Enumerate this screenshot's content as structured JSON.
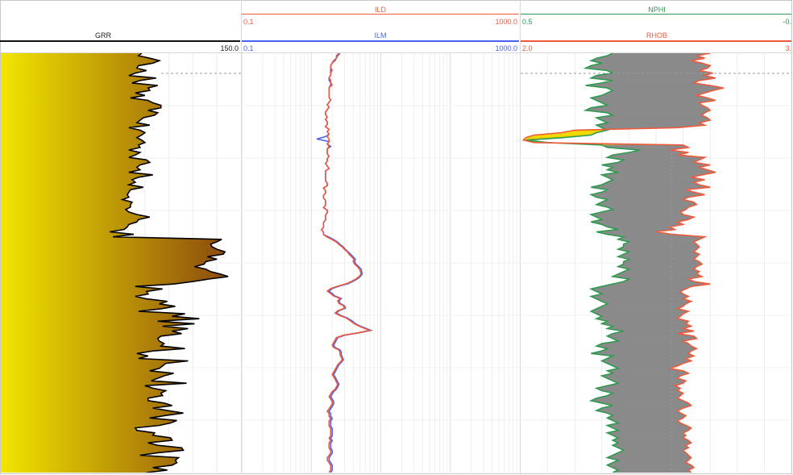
{
  "chart_data": {
    "type": "line",
    "depth_axis": "vertical (top to bottom)",
    "tracks": [
      {
        "name": "gamma-ray-track",
        "curves": [
          {
            "mnemonic": "GRR",
            "color": "#000000",
            "scale_min": null,
            "scale_max": "150.0",
            "fill": "yellow-to-brown gradient (left of curve)"
          }
        ]
      },
      {
        "name": "resistivity-track",
        "scale": "log",
        "curves": [
          {
            "mnemonic": "ILD",
            "color": "#ef5a3c",
            "scale_min": "0.1",
            "scale_max": "1000.0"
          },
          {
            "mnemonic": "ILM",
            "color": "#4a63f0",
            "scale_min": "0.1",
            "scale_max": "1000.0"
          }
        ]
      },
      {
        "name": "porosity-density-track",
        "curves": [
          {
            "mnemonic": "NPHI",
            "color": "#2e9a4f",
            "scale_min": "0.5",
            "scale_max": "-0."
          },
          {
            "mnemonic": "RHOB",
            "color": "#ef5a3c",
            "scale_min": "2.0",
            "scale_max": "3."
          }
        ],
        "fills": [
          "grey crossover",
          "yellow crossover"
        ]
      }
    ],
    "series": [
      {
        "track": 0,
        "name": "GRR",
        "color": "#000000",
        "values": [
          88,
          86,
          93,
          99,
          95,
          86,
          85,
          91,
          84,
          80,
          97,
          87,
          82,
          98,
          92,
          93,
          84,
          90,
          81,
          92,
          95,
          100,
          100,
          92,
          98,
          96,
          89,
          87,
          85,
          93,
          80,
          87,
          90,
          88,
          85,
          88,
          90,
          86,
          87,
          80,
          87,
          84,
          80,
          91,
          93,
          87,
          85,
          87,
          80,
          95,
          86,
          82,
          84,
          80,
          89,
          81,
          80,
          79,
          80,
          76,
          82,
          81,
          81,
          78,
          80,
          85,
          93,
          86,
          85,
          80,
          79,
          77,
          68,
          83,
          70,
          138,
          135,
          131,
          132,
          135,
          140,
          139,
          129,
          135,
          128,
          127,
          121,
          128,
          131,
          137,
          142,
          130,
          120,
          108,
          84,
          101,
          91,
          92,
          84,
          91,
          104,
          99,
          109,
          100,
          86,
          115,
          107,
          124,
          98,
          121,
          101,
          117,
          107,
          113,
          100,
          98,
          99,
          102,
          100,
          115,
          95,
          85,
          92,
          86,
          117,
          103,
          101,
          99,
          93,
          108,
          102,
          98,
          94,
          116,
          90,
          95,
          103,
          100,
          101,
          92,
          92,
          102,
          107,
          95,
          104,
          114,
          103,
          93,
          110,
          106,
          99,
          84,
          85,
          96,
          95,
          106,
          107,
          92,
          98,
          113,
          114,
          98,
          87,
          111,
          109,
          110,
          107,
          95,
          104,
          91
        ]
      },
      {
        "track": 1,
        "name": "ILD",
        "color": "#ef5a3c",
        "values": [
          2.5,
          2.3,
          2.3,
          2.1,
          2.0,
          1.9,
          1.9,
          2.0,
          1.9,
          1.9,
          1.8,
          1.9,
          1.9,
          2.0,
          1.8,
          1.8,
          1.8,
          1.8,
          1.8,
          1.9,
          1.8,
          1.7,
          1.8,
          1.7,
          1.6,
          1.6,
          1.7,
          1.6,
          1.7,
          1.7,
          1.6,
          1.8,
          1.7,
          1.8,
          1.7,
          1.8,
          1.8,
          1.7,
          1.8,
          1.7,
          1.7,
          1.7,
          1.8,
          1.7,
          1.7,
          1.6,
          1.7,
          1.8,
          1.6,
          1.6,
          1.6,
          1.6,
          1.6,
          1.7,
          1.7,
          1.5,
          1.6,
          1.6,
          1.5,
          1.5,
          1.6,
          1.6,
          1.6,
          1.5,
          1.7,
          1.7,
          1.6,
          1.6,
          1.6,
          1.5,
          1.5,
          1.5,
          1.4,
          1.5,
          1.5,
          1.7,
          2.0,
          2.3,
          2.5,
          2.8,
          3.0,
          3.3,
          3.5,
          3.8,
          4.1,
          4.0,
          4.2,
          4.6,
          4.9,
          5.1,
          5.2,
          4.9,
          4.4,
          3.8,
          3.2,
          2.4,
          1.9,
          1.7,
          1.9,
          2.1,
          2.6,
          2.4,
          2.5,
          2.9,
          3.0,
          2.4,
          2.2,
          2.6,
          3.2,
          3.6,
          4.0,
          4.6,
          5.6,
          6.9,
          4.7,
          2.9,
          2.3,
          2.2,
          2.1,
          2.0,
          2.1,
          2.5,
          2.6,
          2.6,
          2.7,
          2.8,
          2.6,
          2.4,
          2.3,
          2.2,
          2.1,
          2.0,
          2.1,
          2.2,
          2.3,
          2.4,
          2.3,
          2.2,
          2.0,
          1.9,
          1.8,
          1.9,
          2.0,
          2.0,
          1.9,
          1.8,
          1.7,
          1.8,
          1.8,
          1.9,
          1.8,
          1.8,
          1.8,
          1.9,
          1.9,
          1.9,
          1.9,
          1.8,
          1.9,
          1.8,
          1.8,
          1.8,
          1.9,
          1.9,
          1.8,
          1.7,
          1.7,
          1.8,
          1.9,
          1.9,
          1.9,
          1.8
        ]
      },
      {
        "track": 1,
        "name": "ILM",
        "color": "#4a63f0",
        "values": [
          2.6,
          2.4,
          2.3,
          2.2,
          2.0,
          1.9,
          1.9,
          1.9,
          1.9,
          1.9,
          1.8,
          1.8,
          1.9,
          1.9,
          1.8,
          1.8,
          1.8,
          1.8,
          1.8,
          1.9,
          1.8,
          1.7,
          1.8,
          1.7,
          1.6,
          1.6,
          1.7,
          1.6,
          1.7,
          1.7,
          1.6,
          1.8,
          1.7,
          1.8,
          1.6,
          1.2,
          1.8,
          1.7,
          1.9,
          1.7,
          1.7,
          1.7,
          1.8,
          1.7,
          1.7,
          1.6,
          1.7,
          1.8,
          1.6,
          1.6,
          1.6,
          1.6,
          1.6,
          1.7,
          1.7,
          1.5,
          1.6,
          1.6,
          1.5,
          1.5,
          1.6,
          1.6,
          1.6,
          1.5,
          1.7,
          1.7,
          1.6,
          1.6,
          1.6,
          1.5,
          1.5,
          1.5,
          1.4,
          1.5,
          1.5,
          1.8,
          2.1,
          2.4,
          2.6,
          2.9,
          3.1,
          3.4,
          3.7,
          4.0,
          4.3,
          4.2,
          4.4,
          4.8,
          5.2,
          5.3,
          5.4,
          5.1,
          4.6,
          4.0,
          3.4,
          2.5,
          2.0,
          1.8,
          2.0,
          2.2,
          2.7,
          2.5,
          2.6,
          3.0,
          3.1,
          2.5,
          2.3,
          2.7,
          3.3,
          3.8,
          4.2,
          4.8,
          5.9,
          7.2,
          4.9,
          3.0,
          2.4,
          2.3,
          2.2,
          2.1,
          2.2,
          2.6,
          2.7,
          2.7,
          2.8,
          2.9,
          2.7,
          2.5,
          2.4,
          2.3,
          2.2,
          2.1,
          2.2,
          2.3,
          2.4,
          2.5,
          2.4,
          2.3,
          2.1,
          2.0,
          1.9,
          2.0,
          2.1,
          2.1,
          2.0,
          1.9,
          1.8,
          1.9,
          1.9,
          2.0,
          1.9,
          1.9,
          1.9,
          2.0,
          2.0,
          2.0,
          2.0,
          1.9,
          2.0,
          1.9,
          1.9,
          1.9,
          2.0,
          2.0,
          1.9,
          1.8,
          1.8,
          1.9,
          2.0,
          2.0,
          2.0,
          1.9
        ]
      },
      {
        "track": 2,
        "name": "NPHI",
        "color": "#2e9a4f",
        "values": [
          0.33,
          0.34,
          0.36,
          0.37,
          0.35,
          0.37,
          0.38,
          0.34,
          0.33,
          0.36,
          0.37,
          0.33,
          0.35,
          0.38,
          0.34,
          0.33,
          0.34,
          0.35,
          0.37,
          0.36,
          0.35,
          0.34,
          0.37,
          0.38,
          0.34,
          0.33,
          0.36,
          0.35,
          0.34,
          0.36,
          0.35,
          0.34,
          0.36,
          0.37,
          0.42,
          0.49,
          0.45,
          0.35,
          0.34,
          0.28,
          0.3,
          0.33,
          0.34,
          0.31,
          0.32,
          0.35,
          0.33,
          0.34,
          0.32,
          0.35,
          0.34,
          0.33,
          0.34,
          0.35,
          0.37,
          0.34,
          0.35,
          0.37,
          0.36,
          0.34,
          0.35,
          0.36,
          0.34,
          0.33,
          0.35,
          0.37,
          0.36,
          0.35,
          0.37,
          0.35,
          0.34,
          0.32,
          0.36,
          0.34,
          0.31,
          0.32,
          0.3,
          0.31,
          0.31,
          0.32,
          0.3,
          0.31,
          0.32,
          0.3,
          0.31,
          0.31,
          0.32,
          0.3,
          0.31,
          0.32,
          0.33,
          0.3,
          0.31,
          0.33,
          0.35,
          0.37,
          0.36,
          0.35,
          0.37,
          0.36,
          0.35,
          0.34,
          0.35,
          0.36,
          0.37,
          0.36,
          0.35,
          0.36,
          0.34,
          0.35,
          0.33,
          0.34,
          0.31,
          0.33,
          0.34,
          0.33,
          0.32,
          0.35,
          0.36,
          0.34,
          0.35,
          0.37,
          0.33,
          0.34,
          0.35,
          0.34,
          0.33,
          0.32,
          0.34,
          0.33,
          0.35,
          0.34,
          0.33,
          0.32,
          0.34,
          0.36,
          0.35,
          0.33,
          0.34,
          0.36,
          0.37,
          0.35,
          0.33,
          0.35,
          0.36,
          0.34,
          0.33,
          0.34,
          0.33,
          0.32,
          0.34,
          0.33,
          0.32,
          0.34,
          0.33,
          0.32,
          0.33,
          0.32,
          0.33,
          0.32,
          0.31,
          0.32,
          0.33,
          0.34,
          0.32,
          0.33,
          0.34,
          0.33,
          0.32,
          0.33
        ]
      },
      {
        "track": 2,
        "name": "RHOB",
        "color": "#ef5a3c",
        "values": [
          2.7,
          2.65,
          2.68,
          2.63,
          2.67,
          2.7,
          2.69,
          2.66,
          2.71,
          2.68,
          2.72,
          2.66,
          2.64,
          2.7,
          2.75,
          2.71,
          2.68,
          2.65,
          2.69,
          2.72,
          2.66,
          2.67,
          2.69,
          2.7,
          2.68,
          2.67,
          2.69,
          2.7,
          2.66,
          2.68,
          2.58,
          2.2,
          2.15,
          2.05,
          2.02,
          2.01,
          2.05,
          2.6,
          2.62,
          2.55,
          2.62,
          2.58,
          2.68,
          2.66,
          2.64,
          2.7,
          2.66,
          2.69,
          2.72,
          2.67,
          2.63,
          2.68,
          2.64,
          2.66,
          2.7,
          2.61,
          2.64,
          2.68,
          2.62,
          2.6,
          2.64,
          2.65,
          2.62,
          2.61,
          2.59,
          2.6,
          2.64,
          2.62,
          2.58,
          2.6,
          2.55,
          2.57,
          2.5,
          2.56,
          2.68,
          2.66,
          2.64,
          2.65,
          2.66,
          2.65,
          2.64,
          2.66,
          2.65,
          2.64,
          2.66,
          2.67,
          2.65,
          2.64,
          2.66,
          2.65,
          2.67,
          2.62,
          2.64,
          2.7,
          2.63,
          2.61,
          2.59,
          2.6,
          2.62,
          2.6,
          2.63,
          2.61,
          2.6,
          2.58,
          2.62,
          2.6,
          2.59,
          2.58,
          2.62,
          2.61,
          2.63,
          2.6,
          2.64,
          2.58,
          2.64,
          2.65,
          2.6,
          2.62,
          2.63,
          2.65,
          2.63,
          2.62,
          2.64,
          2.61,
          2.63,
          2.6,
          2.58,
          2.55,
          2.6,
          2.62,
          2.59,
          2.58,
          2.61,
          2.6,
          2.57,
          2.59,
          2.58,
          2.6,
          2.59,
          2.58,
          2.6,
          2.62,
          2.63,
          2.6,
          2.58,
          2.59,
          2.61,
          2.6,
          2.58,
          2.59,
          2.61,
          2.63,
          2.62,
          2.6,
          2.61,
          2.6,
          2.62,
          2.63,
          2.61,
          2.62,
          2.6,
          2.61,
          2.62,
          2.63,
          2.62,
          2.61,
          2.63,
          2.64,
          2.62,
          2.63
        ]
      }
    ]
  }
}
